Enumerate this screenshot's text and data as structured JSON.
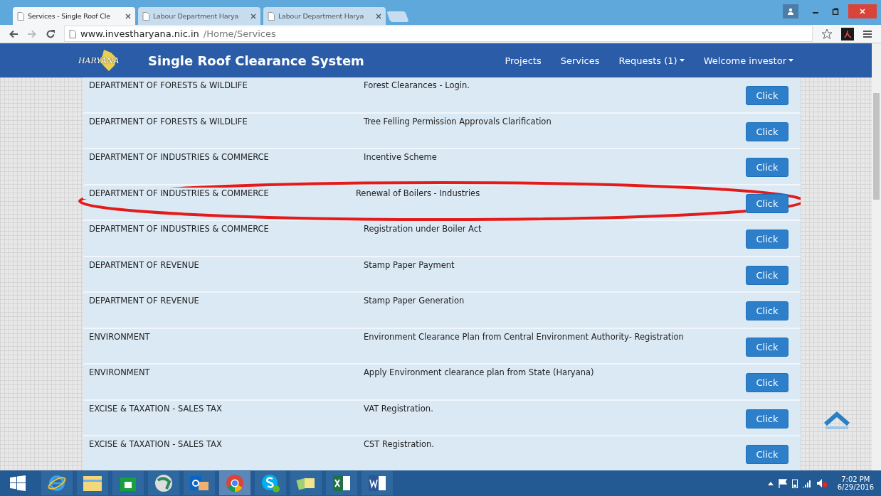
{
  "browser": {
    "tabs": [
      {
        "title": "Services - Single Roof Cle",
        "selected": true
      },
      {
        "title": "Labour Department Harya",
        "selected": false
      },
      {
        "title": "Labour Department Harya",
        "selected": false
      }
    ],
    "address": {
      "host": "www.investharyana.nic.in",
      "path": "/Home/Services"
    }
  },
  "navbar": {
    "logo_text": "HARYANA",
    "title": "Single Roof Clearance System",
    "links": [
      {
        "label": "Projects",
        "dropdown": false
      },
      {
        "label": "Services",
        "dropdown": false
      },
      {
        "label": "Requests (1)",
        "dropdown": true
      },
      {
        "label": "Welcome investor",
        "dropdown": true
      }
    ]
  },
  "services": [
    {
      "department": "DEPARTMENT OF FORESTS & WILDLIFE",
      "service": "Forest Clearances - Login.",
      "action": "Click",
      "highlighted": false
    },
    {
      "department": "DEPARTMENT OF FORESTS & WILDLIFE",
      "service": "Tree Felling Permission Approvals Clarification",
      "action": "Click",
      "highlighted": false
    },
    {
      "department": "DEPARTMENT OF INDUSTRIES & COMMERCE",
      "service": "Incentive Scheme",
      "action": "Click",
      "highlighted": false
    },
    {
      "department": "DEPARTMENT OF INDUSTRIES & COMMERCE",
      "service": "Renewal of Boilers - Industries",
      "action": "Click",
      "highlighted": true
    },
    {
      "department": "DEPARTMENT OF INDUSTRIES & COMMERCE",
      "service": "Registration under Boiler Act",
      "action": "Click",
      "highlighted": false
    },
    {
      "department": "DEPARTMENT OF REVENUE",
      "service": "Stamp Paper Payment",
      "action": "Click",
      "highlighted": false
    },
    {
      "department": "DEPARTMENT OF REVENUE",
      "service": "Stamp Paper Generation",
      "action": "Click",
      "highlighted": false
    },
    {
      "department": "ENVIRONMENT",
      "service": "Environment Clearance Plan from Central Environment Authority- Registration",
      "action": "Click",
      "highlighted": false
    },
    {
      "department": "ENVIRONMENT",
      "service": "Apply Environment clearance plan from State (Haryana)",
      "action": "Click",
      "highlighted": false
    },
    {
      "department": "EXCISE & TAXATION - SALES TAX",
      "service": "VAT Registration.",
      "action": "Click",
      "highlighted": false
    },
    {
      "department": "EXCISE & TAXATION - SALES TAX",
      "service": "CST Registration.",
      "action": "Click",
      "highlighted": false
    }
  ],
  "taskbar": {
    "apps": [
      {
        "kind": "ie",
        "active": false
      },
      {
        "kind": "explorer",
        "active": false
      },
      {
        "kind": "store",
        "active": false
      },
      {
        "kind": "globe",
        "active": false
      },
      {
        "kind": "outlook",
        "active": false
      },
      {
        "kind": "chrome",
        "active": true
      },
      {
        "kind": "skype",
        "active": false
      },
      {
        "kind": "notes",
        "active": false
      },
      {
        "kind": "excel",
        "active": false
      },
      {
        "kind": "word",
        "active": false
      }
    ],
    "time": "7:02 PM",
    "date": "6/29/2016"
  }
}
